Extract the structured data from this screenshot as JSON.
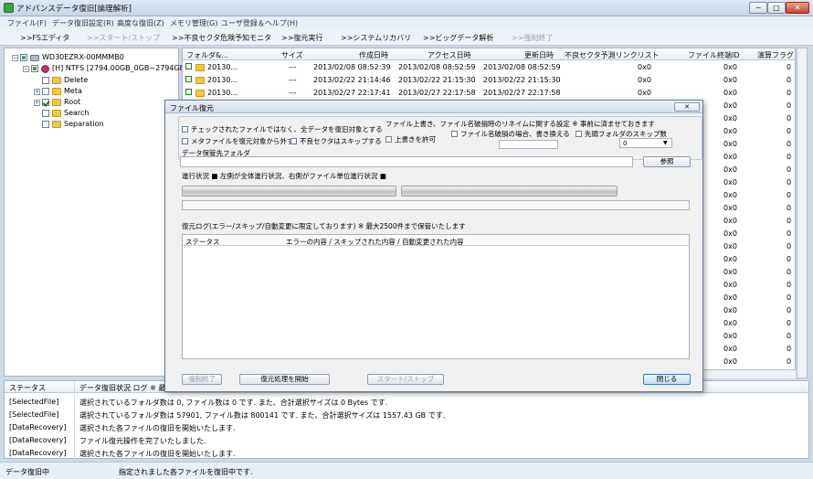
{
  "window": {
    "title": "アドバンスデータ復旧[論理解析]",
    "min": "─",
    "max": "□",
    "close": "✕"
  },
  "menu": [
    "ファイル(F)",
    "データ復旧設定(R)",
    "高度な復旧(Z)",
    "メモリ管理(G)",
    "ユーザ登録＆ヘルプ(H)"
  ],
  "toolbar": [
    {
      "label": ">>FSエディタ",
      "enabled": true
    },
    {
      "label": ">>スタート/ストップ",
      "enabled": false
    },
    {
      "label": ">>不良セクタ危険予知モニタ",
      "enabled": true
    },
    {
      "label": ">>復元実行",
      "enabled": true
    },
    {
      "label": ">>システムリカバリ",
      "enabled": true
    },
    {
      "label": ">>ビッグデータ解析",
      "enabled": true
    },
    {
      "label": ">>強制終了",
      "enabled": false
    }
  ],
  "tree": {
    "drive": "WD30EZRX-00MMMB0",
    "partition": "[H] NTFS [2794.00GB_0GB~2794GB]",
    "folders": [
      {
        "name": "Delete",
        "expandable": false,
        "checked": false
      },
      {
        "name": "Meta",
        "expandable": true,
        "checked": false
      },
      {
        "name": "Root",
        "expandable": true,
        "checked": true
      },
      {
        "name": "Search",
        "expandable": false,
        "checked": false
      },
      {
        "name": "Separation",
        "expandable": false,
        "checked": false
      }
    ]
  },
  "filelist": {
    "columns": [
      "フォルダ&...",
      "サイズ",
      "作成日時",
      "アクセス日時",
      "更新日時",
      "不良セクタ予測リンクリスト",
      "ファイル終端ID",
      "演算フラグ"
    ],
    "rows": [
      {
        "name": "20130...",
        "size": "---",
        "created": "2013/02/08 08:52:39",
        "accessed": "2013/02/08 08:52:59",
        "modified": "2013/02/08 08:52:59",
        "link": "0x0",
        "endid": "0x0",
        "flag": "0"
      },
      {
        "name": "20130...",
        "size": "---",
        "created": "2013/02/22 21:14:46",
        "accessed": "2013/02/22 21:15:30",
        "modified": "2013/02/22 21:15:30",
        "link": "0x0",
        "endid": "0x0",
        "flag": "0"
      },
      {
        "name": "20130...",
        "size": "---",
        "created": "2013/02/27 22:17:41",
        "accessed": "2013/02/27 22:17:58",
        "modified": "2013/02/27 22:17:58",
        "link": "0x0",
        "endid": "0x0",
        "flag": "0"
      }
    ],
    "right_values": [
      "0x0",
      "0",
      "0x0",
      "0",
      "0x0",
      "0",
      "0x0",
      "0",
      "0x0",
      "0",
      "0x0",
      "0",
      "0x0",
      "0",
      "0x0",
      "0",
      "0x0",
      "0",
      "0x0",
      "0",
      "0x0",
      "0",
      "0x0",
      "0",
      "0x0",
      "0",
      "0x0",
      "0",
      "0x0",
      "0",
      "0x0",
      "0",
      "0x0",
      "0",
      "0x0",
      "0",
      "0x0",
      "0",
      "0x0",
      "0",
      "0x0",
      "0",
      "0x0",
      "0",
      "0x0",
      "0",
      "0x0",
      "0",
      "0x0",
      "0"
    ]
  },
  "log": {
    "header_status": "ステータス",
    "header_log": "データ復旧状況 ログ ※ 最大",
    "rows": [
      {
        "status": "[SelectedFile]",
        "msg": "選択されているフォルダ数は 0, ファイル数は 0 です. また、合計選択サイズは 0 Bytes です."
      },
      {
        "status": "[SelectedFile]",
        "msg": "選択されているフォルダ数は 57901, ファイル数は 800141 です. また、合計選択サイズは 1557.43 GB です."
      },
      {
        "status": "[DataRecovery]",
        "msg": "選択された各ファイルの復旧を開始いたします."
      },
      {
        "status": "[DataRecovery]",
        "msg": "ファイル復元操作を完了いたしました."
      },
      {
        "status": "[DataRecovery]",
        "msg": "選択された各ファイルの復旧を開始いたします."
      }
    ]
  },
  "statusbar": {
    "left": "データ復旧中",
    "right": "指定されました各ファイルを復旧中です."
  },
  "dialog": {
    "title": "ファイル復元",
    "close": "✕",
    "opt_all": "チェックされたファイルではなく、全データを復旧対象とする",
    "opt_meta": "メタファイルを復元対象から外す",
    "opt_skip_bad": "不良セクタはスキップする",
    "overwrite_title": "ファイル上書き、ファイル名破損時のリネイムに関する設定 ※ 事前に済ませておきます",
    "opt_overwrite": "上書きを許可",
    "opt_rename": "ファイル名破損の場合、書き換える",
    "opt_skip_first": "先頭フォルダのスキップ数",
    "skip_value": "0",
    "dest_label": "データ保管先フォルダ",
    "dest_value": "",
    "browse": "参照",
    "progress_label": "進行状況 ■ 左側が全体進行状況、右側がファイル単位進行状況 ■",
    "log_label": "復元ログ(エラー/スキップ/自動変更に限定しております) ※ 最大2500件まで保管いたします",
    "log_col_status": "ステータス",
    "log_col_detail": "エラーの内容 / スキップされた内容 / 自動変更された内容",
    "btn_force": "強制終了",
    "btn_start": "復元処理を開始",
    "btn_startstop": "スタート/ストップ",
    "btn_close": "閉じる"
  }
}
